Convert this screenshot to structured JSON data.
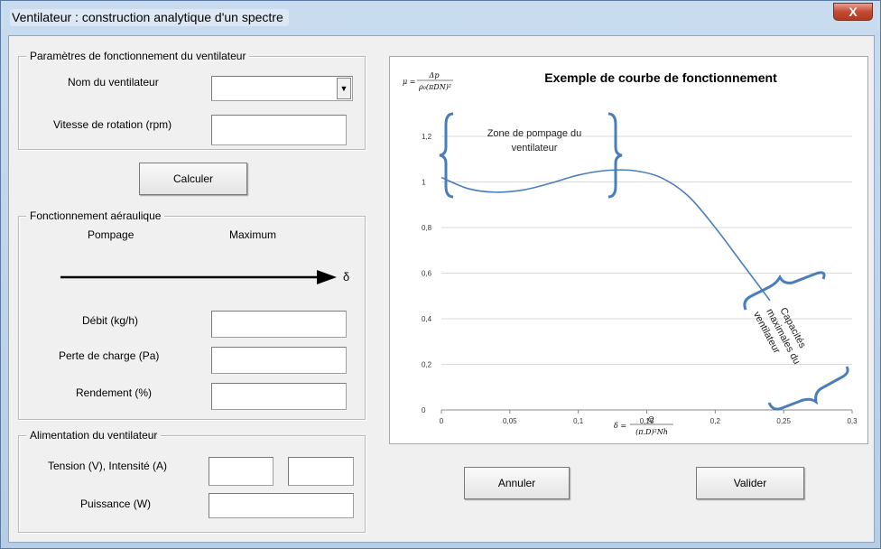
{
  "window": {
    "title": "Ventilateur : construction analytique d'un spectre",
    "close_glyph": "X"
  },
  "params": {
    "legend": "Paramètres de fonctionnement du ventilateur",
    "name_label": "Nom du ventilateur",
    "name_value": "",
    "speed_label": "Vitesse de rotation (rpm)",
    "speed_value": "",
    "combo_arrow_icon": "dropdown-arrow"
  },
  "calc_button": "Calculer",
  "aero": {
    "legend": "Fonctionnement aéraulique",
    "pompage": "Pompage",
    "maximum": "Maximum",
    "delta": "δ",
    "debit_label": "Débit (kg/h)",
    "perte_label": "Perte de charge (Pa)",
    "rendement_label": "Rendement (%)"
  },
  "alim": {
    "legend": "Alimentation du ventilateur",
    "tension_label": "Tension (V), Intensité (A)",
    "puissance_label": "Puissance (W)"
  },
  "buttons": {
    "cancel": "Annuler",
    "ok": "Valider"
  },
  "chart_data": {
    "type": "line",
    "title": "Exemple de courbe de fonctionnement",
    "ylabel": "μ = Δp / (ρ0(πDN)²)",
    "xlabel": "δ = Q / ((π.D)² Nh)",
    "xlim": [
      0,
      0.3
    ],
    "ylim": [
      0,
      1.2
    ],
    "x_ticks": [
      "0",
      "0,05",
      "0,1",
      "0,15",
      "0,2",
      "0,25",
      "0,3"
    ],
    "y_ticks": [
      "0",
      "0,2",
      "0,4",
      "0,6",
      "0,8",
      "1",
      "1,2"
    ],
    "grid": "horizontal",
    "series": [
      {
        "color": "#4a7ebb",
        "x": [
          0,
          0.02,
          0.04,
          0.06,
          0.08,
          0.1,
          0.12,
          0.14,
          0.16,
          0.18,
          0.2,
          0.22,
          0.24
        ],
        "y": [
          1.02,
          0.97,
          0.955,
          0.965,
          0.995,
          1.03,
          1.05,
          1.05,
          1.02,
          0.94,
          0.8,
          0.64,
          0.48
        ]
      }
    ],
    "annotations": [
      {
        "text_lines": [
          "Zone de pompage du",
          "ventilateur"
        ]
      },
      {
        "text_lines": [
          "Capacités",
          "maximales du",
          "ventilateur"
        ]
      }
    ]
  }
}
